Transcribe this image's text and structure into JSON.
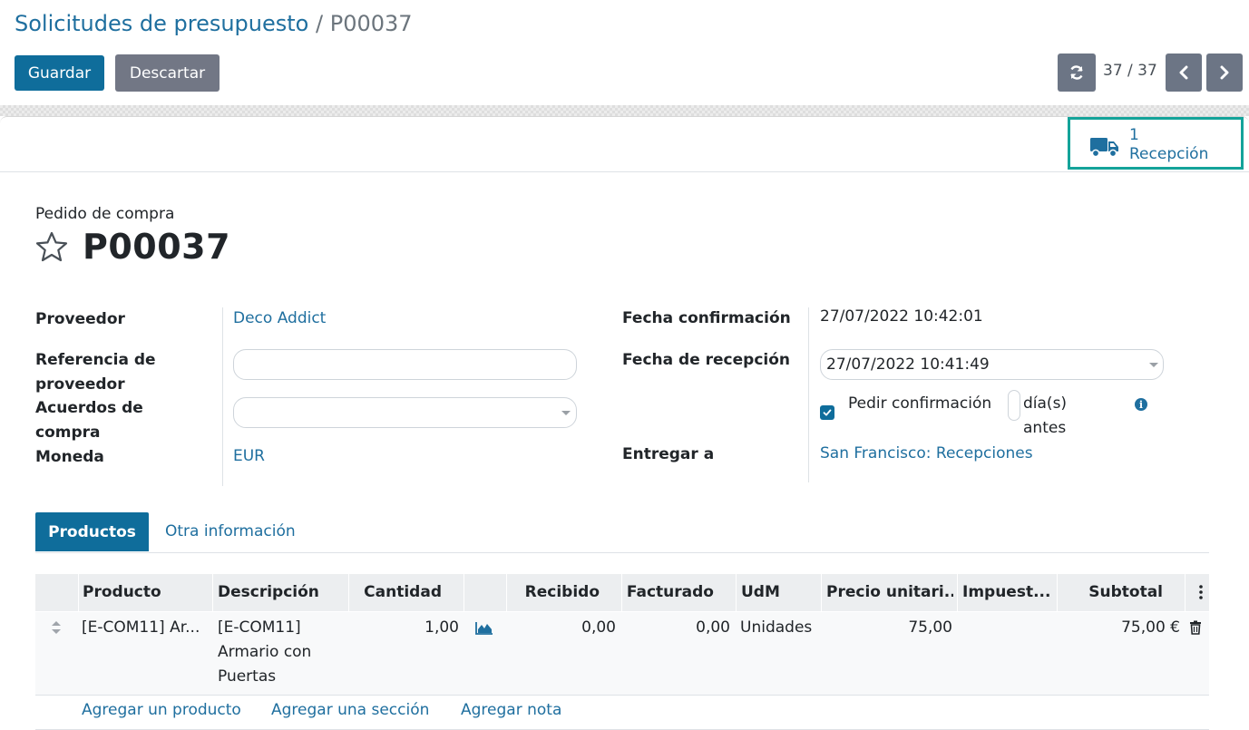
{
  "breadcrumb": {
    "parent": "Solicitudes de presupuesto",
    "separator": "/",
    "current": "P00037"
  },
  "toolbar": {
    "save_label": "Guardar",
    "discard_label": "Descartar"
  },
  "pager": {
    "value": "37 / 37"
  },
  "icons": {
    "refresh": "refresh-icon",
    "prev": "chevron-left-icon",
    "next": "chevron-right-icon",
    "truck": "truck-icon",
    "star": "star-icon",
    "info": "info-icon",
    "chart": "area-chart-icon",
    "trash": "trash-icon",
    "handle": "drag-handle-icon",
    "kebab": "kebab-icon"
  },
  "smart_button": {
    "count": "1",
    "label": "Recepción"
  },
  "order": {
    "label": "Pedido de compra",
    "name": "P00037"
  },
  "fields_left": {
    "vendor_label": "Proveedor",
    "vendor_value": "Deco Addict",
    "vendor_ref_label": "Referencia de proveedor",
    "vendor_ref_value": "",
    "agreement_label": "Acuerdos de compra",
    "agreement_value": "",
    "currency_label": "Moneda",
    "currency_value": "EUR"
  },
  "fields_right": {
    "confirm_date_label": "Fecha confirmación",
    "confirm_date_value": "27/07/2022 10:42:01",
    "receipt_date_label": "Fecha de recepción",
    "receipt_date_value": "27/07/2022 10:41:49",
    "ask_confirm_label": "Pedir confirmación",
    "ask_confirm_checked": true,
    "days_unit": "día(s)",
    "days_after": "antes",
    "deliver_to_label": "Entregar a",
    "deliver_to_value": "San Francisco: Recepciones"
  },
  "tabs": [
    {
      "label": "Productos",
      "active": true
    },
    {
      "label": "Otra información",
      "active": false
    }
  ],
  "table": {
    "columns": [
      "Producto",
      "Descripción",
      "Cantidad",
      "",
      "Recibido",
      "Facturado",
      "UdM",
      "Precio unitari...",
      "Impuest...",
      "Subtotal"
    ],
    "rows": [
      {
        "product": "[E-COM11] Ar...",
        "description_1": "[E-COM11]",
        "description_2": "Armario con",
        "description_3": "Puertas",
        "quantity": "1,00",
        "received": "0,00",
        "invoiced": "0,00",
        "uom": "Unidades",
        "unit_price": "75,00",
        "taxes": "",
        "subtotal": "75,00 €"
      }
    ],
    "add_product": "Agregar un producto",
    "add_section": "Agregar una sección",
    "add_note": "Agregar nota"
  },
  "colors": {
    "accent": "#0f6d9b",
    "link": "#1f6f9f",
    "secondary": "#727785",
    "highlight": "#14a39a"
  }
}
